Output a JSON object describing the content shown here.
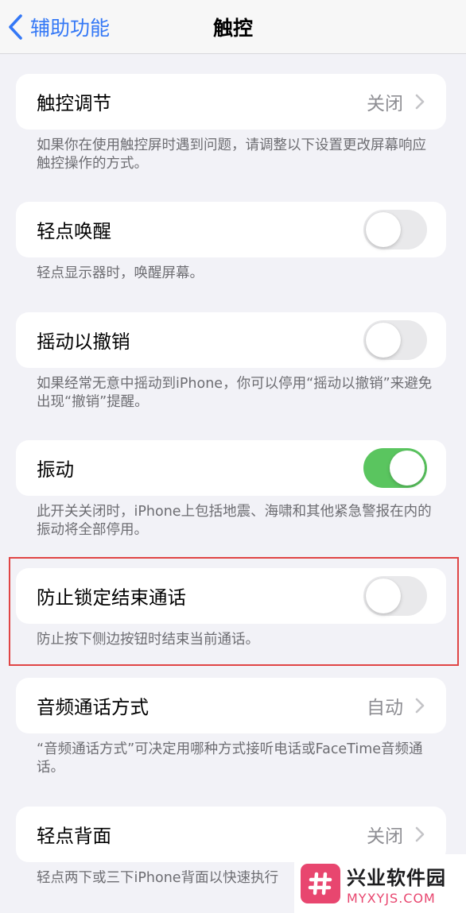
{
  "nav": {
    "back_label": "辅助功能",
    "title": "触控"
  },
  "rows": {
    "touch_accommodations": {
      "label": "触控调节",
      "value": "关闭",
      "footer": "如果你在使用触控屏时遇到问题，请调整以下设置更改屏幕响应触控操作的方式。"
    },
    "tap_to_wake": {
      "label": "轻点唤醒",
      "toggle": "off",
      "footer": "轻点显示器时，唤醒屏幕。"
    },
    "shake_to_undo": {
      "label": "摇动以撤销",
      "toggle": "off",
      "footer": "如果经常无意中摇动到iPhone，你可以停用“摇动以撤销”来避免出现“撤销”提醒。"
    },
    "vibration": {
      "label": "振动",
      "toggle": "on",
      "footer": "此开关关闭时，iPhone上包括地震、海啸和其他紧急警报在内的振动将全部停用。"
    },
    "prevent_lock_end_call": {
      "label": "防止锁定结束通话",
      "toggle": "off",
      "footer": "防止按下侧边按钮时结束当前通话。"
    },
    "call_audio_routing": {
      "label": "音频通话方式",
      "value": "自动",
      "footer": "“音频通话方式”可决定用哪种方式接听电话或FaceTime音频通话。"
    },
    "back_tap": {
      "label": "轻点背面",
      "value": "关闭",
      "footer": "轻点两下或三下iPhone背面以快速执行"
    }
  },
  "watermark": {
    "name": "兴业软件园",
    "url": "MYXYJS.COM"
  },
  "colors": {
    "accent": "#3478f6",
    "toggle_on": "#5ac55f",
    "highlight": "#e04545",
    "watermark": "#e8466f"
  }
}
